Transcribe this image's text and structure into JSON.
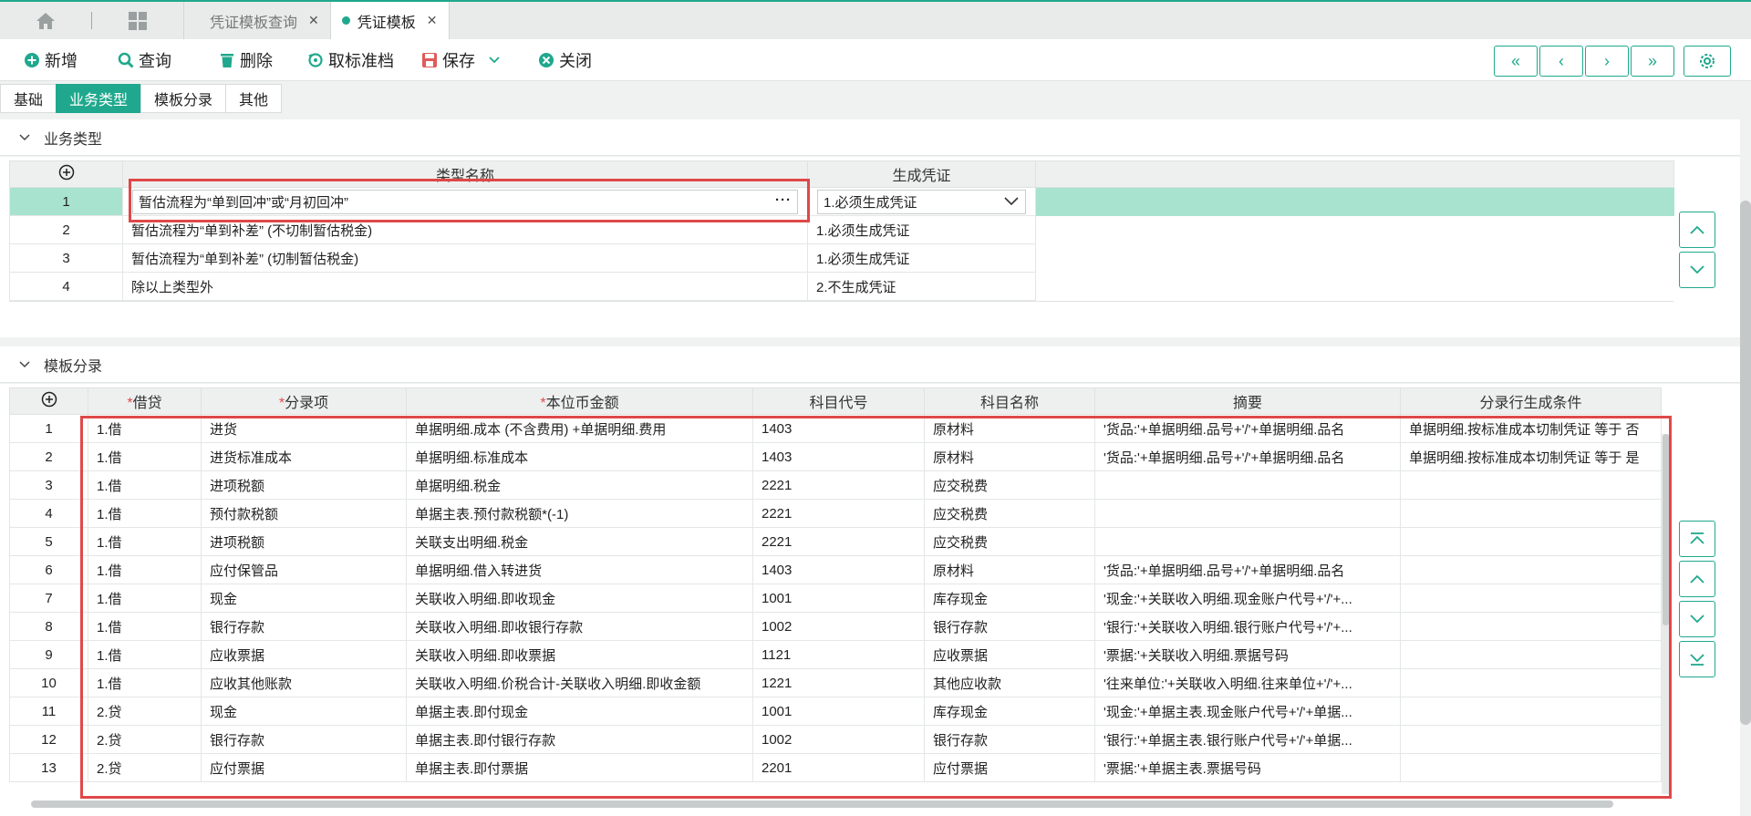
{
  "tabs": {
    "items": [
      {
        "label": "凭证模板查询",
        "active": false
      },
      {
        "label": "凭证模板",
        "active": true
      }
    ]
  },
  "toolbar": {
    "add": "新增",
    "query": "查询",
    "delete": "删除",
    "cancel_standard": "取标准档",
    "save": "保存",
    "close": "关闭"
  },
  "subtabs": [
    "基础",
    "业务类型",
    "模板分录",
    "其他"
  ],
  "business_section": {
    "title": "业务类型",
    "columns": [
      "类型名称",
      "生成凭证"
    ],
    "rows": [
      {
        "no": "1",
        "name": "暂估流程为“单到回冲”或“月初回冲”",
        "gen": "1.必须生成凭证"
      },
      {
        "no": "2",
        "name": "暂估流程为“单到补差” (不切制暂估税金)",
        "gen": "1.必须生成凭证"
      },
      {
        "no": "3",
        "name": "暂估流程为“单到补差” (切制暂估税金)",
        "gen": "1.必须生成凭证"
      },
      {
        "no": "4",
        "name": "除以上类型外",
        "gen": "2.不生成凭证"
      }
    ]
  },
  "entry_section": {
    "title": "模板分录",
    "columns": {
      "dc": "借贷",
      "item": "分录项",
      "amount": "本位币金额",
      "code": "科目代号",
      "subject": "科目名称",
      "summary": "摘要",
      "condition": "分录行生成条件"
    },
    "rows": [
      {
        "no": "1",
        "dc": "1.借",
        "item": "进货",
        "amount": "单据明细.成本 (不含费用) +单据明细.费用",
        "code": "1403",
        "subject": "原材料",
        "summary": "'货品:'+单据明细.品号+'/'+单据明细.品名",
        "condition": "单据明细.按标准成本切制凭证 等于 否"
      },
      {
        "no": "2",
        "dc": "1.借",
        "item": "进货标准成本",
        "amount": "单据明细.标准成本",
        "code": "1403",
        "subject": "原材料",
        "summary": "'货品:'+单据明细.品号+'/'+单据明细.品名",
        "condition": "单据明细.按标准成本切制凭证 等于 是"
      },
      {
        "no": "3",
        "dc": "1.借",
        "item": "进项税额",
        "amount": "单据明细.税金",
        "code": "2221",
        "subject": "应交税费",
        "summary": "",
        "condition": ""
      },
      {
        "no": "4",
        "dc": "1.借",
        "item": "预付款税额",
        "amount": "单据主表.预付款税额*(-1)",
        "code": "2221",
        "subject": "应交税费",
        "summary": "",
        "condition": ""
      },
      {
        "no": "5",
        "dc": "1.借",
        "item": "进项税额",
        "amount": "关联支出明细.税金",
        "code": "2221",
        "subject": "应交税费",
        "summary": "",
        "condition": ""
      },
      {
        "no": "6",
        "dc": "1.借",
        "item": "应付保管品",
        "amount": "单据明细.借入转进货",
        "code": "1403",
        "subject": "原材料",
        "summary": "'货品:'+单据明细.品号+'/'+单据明细.品名",
        "condition": ""
      },
      {
        "no": "7",
        "dc": "1.借",
        "item": "现金",
        "amount": "关联收入明细.即收现金",
        "code": "1001",
        "subject": "库存现金",
        "summary": "'现金:'+关联收入明细.现金账户代号+'/'+...",
        "condition": ""
      },
      {
        "no": "8",
        "dc": "1.借",
        "item": "银行存款",
        "amount": "关联收入明细.即收银行存款",
        "code": "1002",
        "subject": "银行存款",
        "summary": "'银行:'+关联收入明细.银行账户代号+'/'+...",
        "condition": ""
      },
      {
        "no": "9",
        "dc": "1.借",
        "item": "应收票据",
        "amount": "关联收入明细.即收票据",
        "code": "1121",
        "subject": "应收票据",
        "summary": "'票据:'+关联收入明细.票据号码",
        "condition": ""
      },
      {
        "no": "10",
        "dc": "1.借",
        "item": "应收其他账款",
        "amount": "关联收入明细.价税合计-关联收入明细.即收金额",
        "code": "1221",
        "subject": "其他应收款",
        "summary": "'往来单位:'+关联收入明细.往来单位+'/'+...",
        "condition": ""
      },
      {
        "no": "11",
        "dc": "2.贷",
        "item": "现金",
        "amount": "单据主表.即付现金",
        "code": "1001",
        "subject": "库存现金",
        "summary": "'现金:'+单据主表.现金账户代号+'/'+单据...",
        "condition": ""
      },
      {
        "no": "12",
        "dc": "2.贷",
        "item": "银行存款",
        "amount": "单据主表.即付银行存款",
        "code": "1002",
        "subject": "银行存款",
        "summary": "'银行:'+单据主表.银行账户代号+'/'+单据...",
        "condition": ""
      },
      {
        "no": "13",
        "dc": "2.贷",
        "item": "应付票据",
        "amount": "单据主表.即付票据",
        "code": "2201",
        "subject": "应付票据",
        "summary": "'票据:'+单据主表.票据号码",
        "condition": ""
      }
    ]
  },
  "colors": {
    "accent": "#1fa88d",
    "highlight": "#e04848",
    "selected_row": "#a8e3cf"
  }
}
